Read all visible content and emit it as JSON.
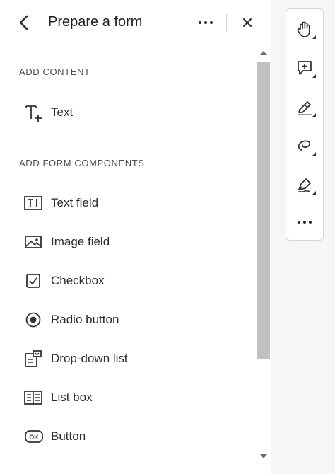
{
  "header": {
    "title": "Prepare a form",
    "back_icon": "chevron-left-icon",
    "more_icon": "ellipsis-icon",
    "close_icon": "close-icon"
  },
  "add_content": {
    "heading": "ADD CONTENT",
    "items": [
      {
        "label": "Text",
        "icon": "text-add-icon"
      }
    ]
  },
  "add_form_components": {
    "heading": "ADD FORM COMPONENTS",
    "items": [
      {
        "label": "Text field",
        "icon": "text-field-icon"
      },
      {
        "label": "Image field",
        "icon": "image-icon"
      },
      {
        "label": "Checkbox",
        "icon": "checkbox-icon"
      },
      {
        "label": "Radio button",
        "icon": "radio-button-icon"
      },
      {
        "label": "Drop-down list",
        "icon": "dropdown-list-icon"
      },
      {
        "label": "List box",
        "icon": "list-box-icon"
      },
      {
        "label": "Button",
        "icon": "ok-button-icon"
      }
    ]
  },
  "toolbar": {
    "tools": [
      {
        "icon": "hand-icon"
      },
      {
        "icon": "comment-add-icon"
      },
      {
        "icon": "highlighter-icon"
      },
      {
        "icon": "lasso-icon"
      },
      {
        "icon": "pen-sign-icon"
      },
      {
        "icon": "ellipsis-icon"
      }
    ]
  },
  "colors": {
    "panel_bg": "#ffffff",
    "app_bg": "#f6f6f6",
    "text": "#2c2c2c",
    "scroll_thumb": "#c1c1c1"
  }
}
